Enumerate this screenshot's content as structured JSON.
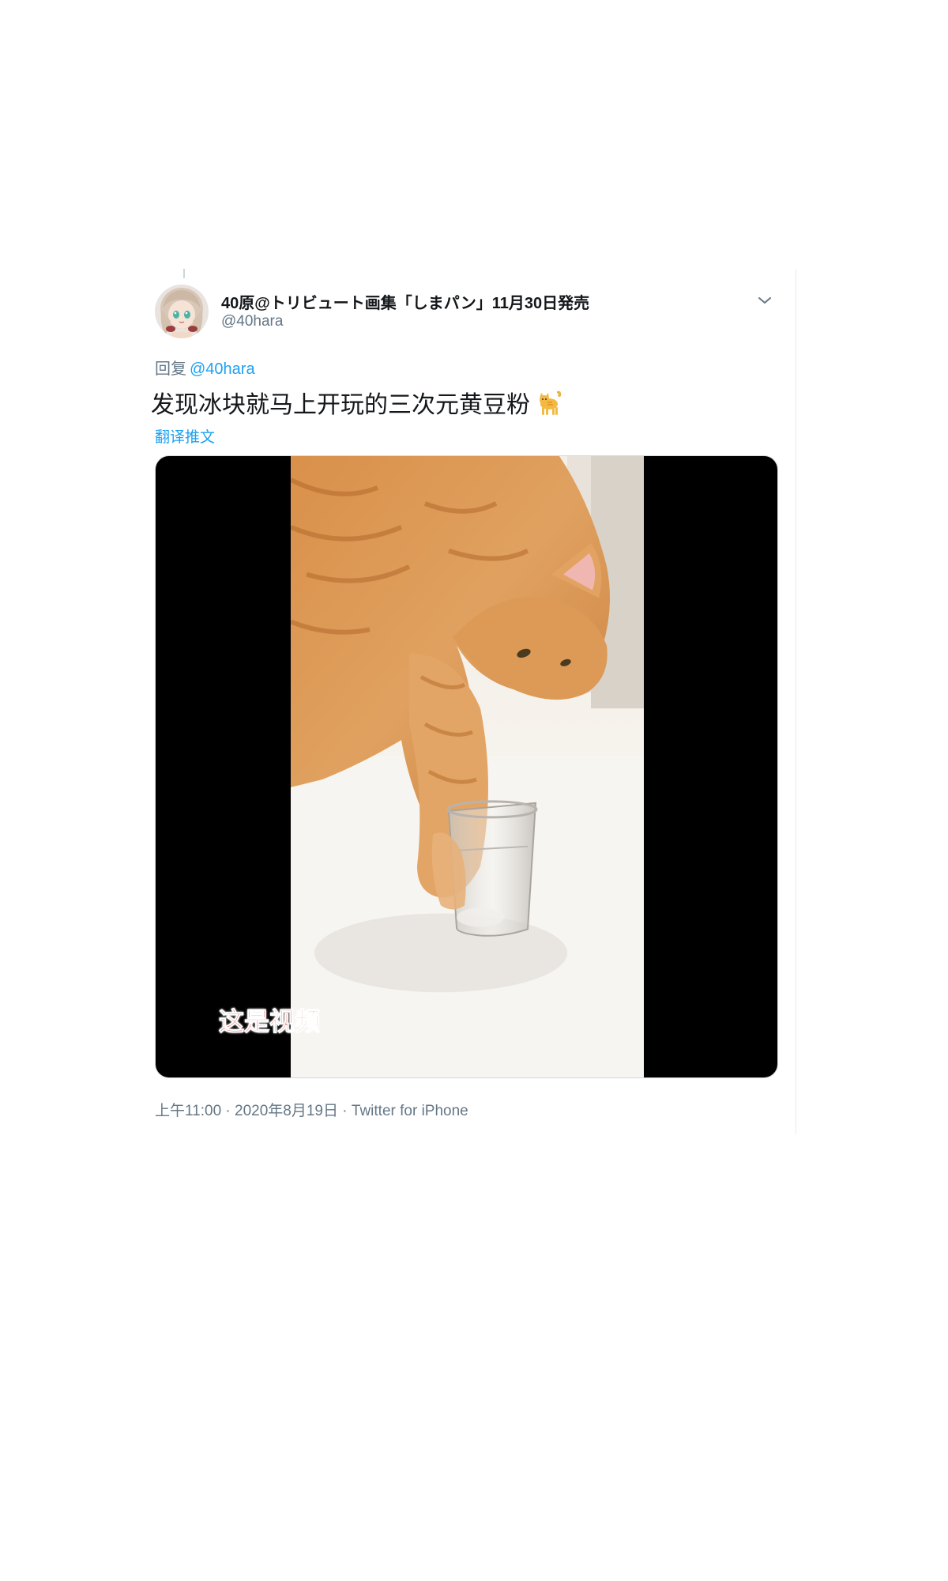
{
  "tweet": {
    "user": {
      "display_name": "40原@トリビュート画集「しまパン」11月30日発売",
      "handle": "@40hara",
      "avatar_icon": "avatar-girl-illustration"
    },
    "menu_icon": "chevron-down-icon",
    "reply": {
      "prefix": "回复",
      "handle": "@40hara"
    },
    "text": "发现冰块就马上开玩的三次元黄豆粉",
    "text_emoji": "cat-emoji",
    "translate_label": "翻译推文",
    "media": {
      "type": "video",
      "caption": "这是视频"
    },
    "meta": {
      "time": "上午11:00",
      "separator1": " · ",
      "date": "2020年8月19日",
      "separator2": " · ",
      "source": "Twitter for iPhone"
    }
  },
  "colors": {
    "link_blue": "#1da1f2",
    "secondary_text": "#657786",
    "primary_text": "#14171a",
    "caption_red": "#e0201b"
  }
}
